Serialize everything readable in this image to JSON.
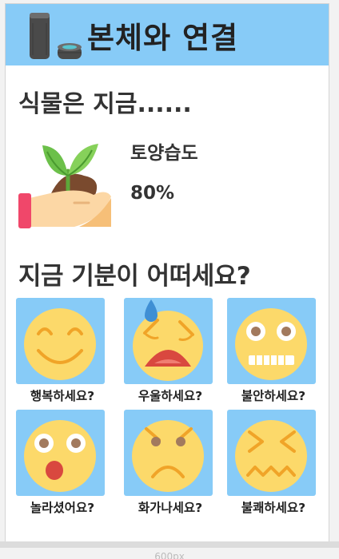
{
  "header": {
    "title": "본체와 연결",
    "icon": "smart-speaker-icon",
    "background": "#87cbf7"
  },
  "plant_status": {
    "title": "식물은 지금......",
    "icon": "plant-in-hand-icon",
    "sensor_label": "토양습도",
    "sensor_value": "80%"
  },
  "mood": {
    "title": "지금 기분이 어떠세요?",
    "tile_color": "#87cbf7",
    "options": [
      {
        "label": "행복하세요?",
        "icon": "happy-face-icon"
      },
      {
        "label": "우울하세요?",
        "icon": "sad-sweat-face-icon"
      },
      {
        "label": "불안하세요?",
        "icon": "anxious-face-icon"
      },
      {
        "label": "놀라셨어요?",
        "icon": "surprised-face-icon"
      },
      {
        "label": "화가나세요?",
        "icon": "angry-face-icon"
      },
      {
        "label": "불쾌하세요?",
        "icon": "annoyed-face-icon"
      }
    ]
  },
  "footer": {
    "width_hint": "600px"
  }
}
